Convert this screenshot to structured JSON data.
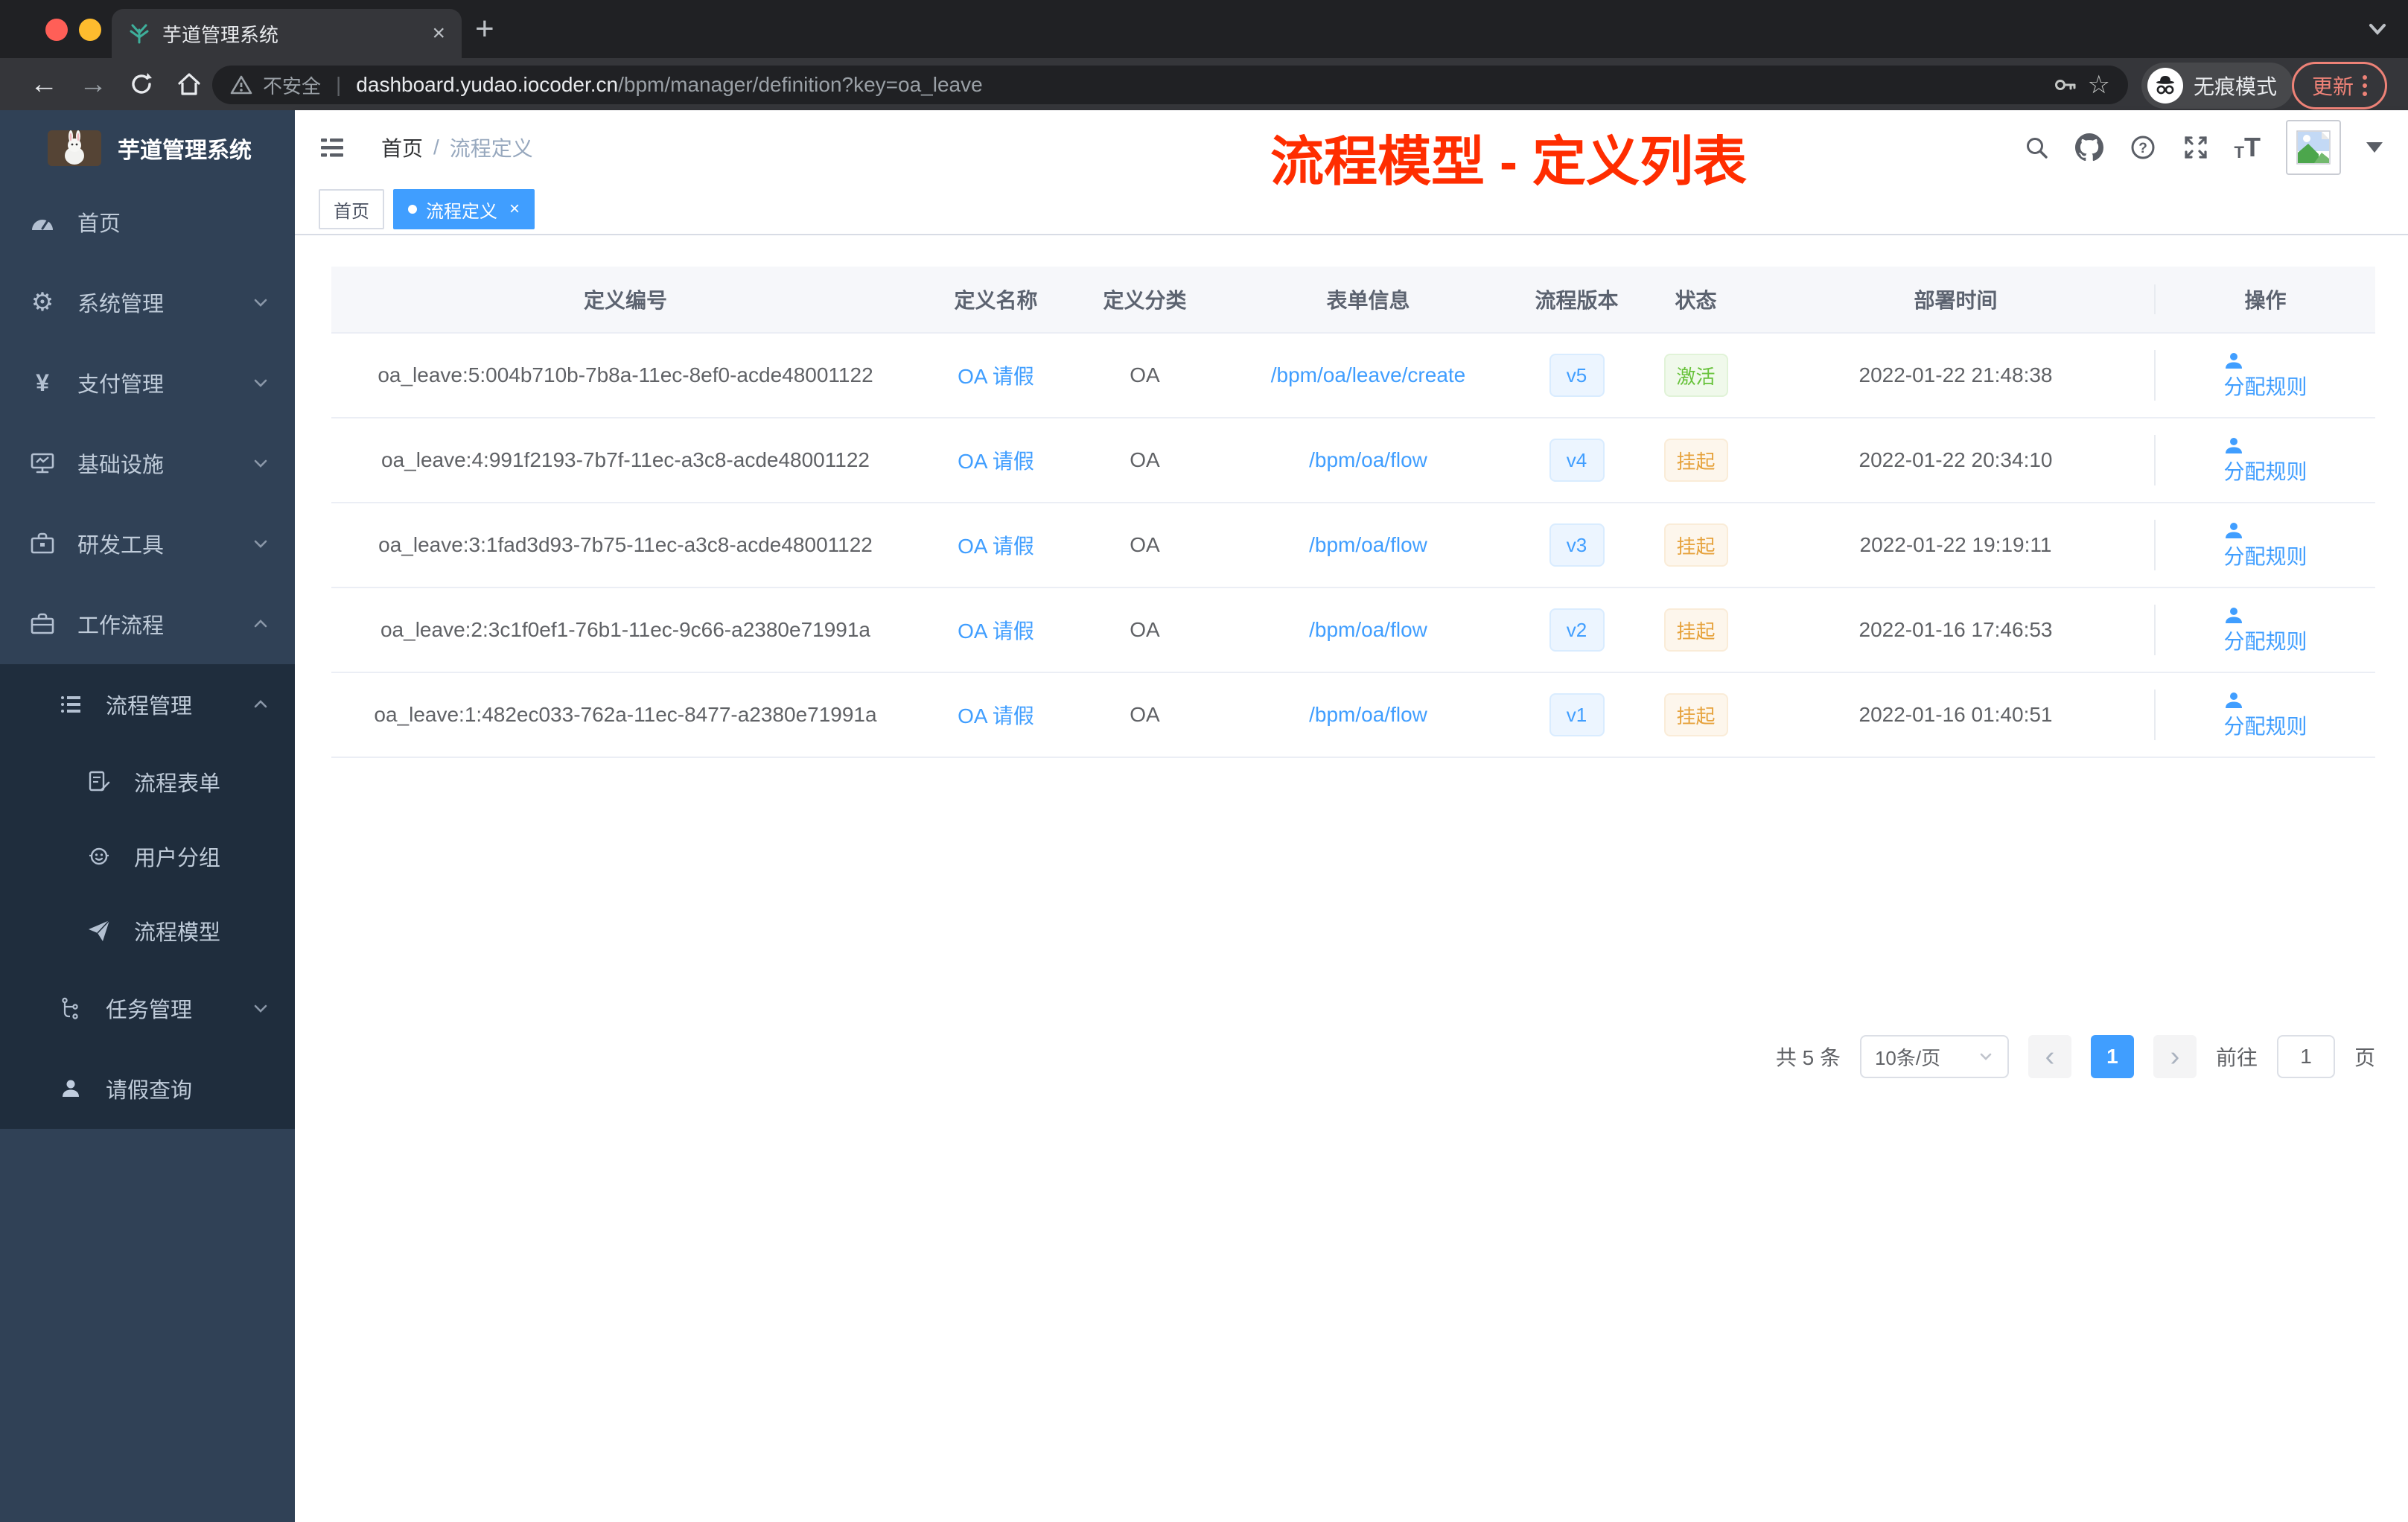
{
  "browser": {
    "tab_title": "芋道管理系统",
    "new_tab": "+",
    "tab_close": "×",
    "security_label": "不安全",
    "url_host": "dashboard.yudao.iocoder.cn",
    "url_path": "/bpm/manager/definition?key=oa_leave",
    "incognito_label": "无痕模式",
    "update_label": "更新"
  },
  "sidebar": {
    "logo_title": "芋道管理系统",
    "items": [
      {
        "label": "首页"
      },
      {
        "label": "系统管理"
      },
      {
        "label": "支付管理"
      },
      {
        "label": "基础设施"
      },
      {
        "label": "研发工具"
      },
      {
        "label": "工作流程"
      },
      {
        "label": "流程管理"
      },
      {
        "label": "流程表单"
      },
      {
        "label": "用户分组"
      },
      {
        "label": "流程模型"
      },
      {
        "label": "任务管理"
      },
      {
        "label": "请假查询"
      }
    ]
  },
  "navbar": {
    "breadcrumb_home": "首页",
    "breadcrumb_sep": "/",
    "breadcrumb_current": "流程定义"
  },
  "annotation": {
    "text": "流程模型 - 定义列表",
    "color": "#ff2d00"
  },
  "tags": [
    {
      "label": "首页"
    },
    {
      "label": "流程定义",
      "close": "×"
    }
  ],
  "table": {
    "columns": [
      "定义编号",
      "定义名称",
      "定义分类",
      "表单信息",
      "流程版本",
      "状态",
      "部署时间",
      "操作"
    ],
    "action_label": "分配规则",
    "rows": [
      {
        "id": "oa_leave:5:004b710b-7b8a-11ec-8ef0-acde48001122",
        "name": "OA 请假",
        "category": "OA",
        "form": "/bpm/oa/leave/create",
        "version": "v5",
        "status": "激活",
        "status_type": "success",
        "deploy_time": "2022-01-22 21:48:38",
        "action": "分配规则"
      },
      {
        "id": "oa_leave:4:991f2193-7b7f-11ec-a3c8-acde48001122",
        "name": "OA 请假",
        "category": "OA",
        "form": "/bpm/oa/flow",
        "version": "v4",
        "status": "挂起",
        "status_type": "warning",
        "deploy_time": "2022-01-22 20:34:10",
        "action": "分配规则"
      },
      {
        "id": "oa_leave:3:1fad3d93-7b75-11ec-a3c8-acde48001122",
        "name": "OA 请假",
        "category": "OA",
        "form": "/bpm/oa/flow",
        "version": "v3",
        "status": "挂起",
        "status_type": "warning",
        "deploy_time": "2022-01-22 19:19:11",
        "action": "分配规则"
      },
      {
        "id": "oa_leave:2:3c1f0ef1-76b1-11ec-9c66-a2380e71991a",
        "name": "OA 请假",
        "category": "OA",
        "form": "/bpm/oa/flow",
        "version": "v2",
        "status": "挂起",
        "status_type": "warning",
        "deploy_time": "2022-01-16 17:46:53",
        "action": "分配规则"
      },
      {
        "id": "oa_leave:1:482ec033-762a-11ec-8477-a2380e71991a",
        "name": "OA 请假",
        "category": "OA",
        "form": "/bpm/oa/flow",
        "version": "v1",
        "status": "挂起",
        "status_type": "warning",
        "deploy_time": "2022-01-16 01:40:51",
        "action": "分配规则"
      }
    ]
  },
  "pagination": {
    "total_text": "共 5 条",
    "page_size": "10条/页",
    "prev": "‹",
    "current_page": "1",
    "next": "›",
    "goto_label": "前往",
    "goto_value": "1",
    "page_suffix": "页"
  },
  "colors": {
    "accent": "#409eff",
    "annotation_red": "#ff2d00",
    "sidebar_bg": "#304156",
    "submenu_bg": "#1f2d3d",
    "status_active": "#67c23a",
    "status_suspended": "#e6a23c"
  }
}
